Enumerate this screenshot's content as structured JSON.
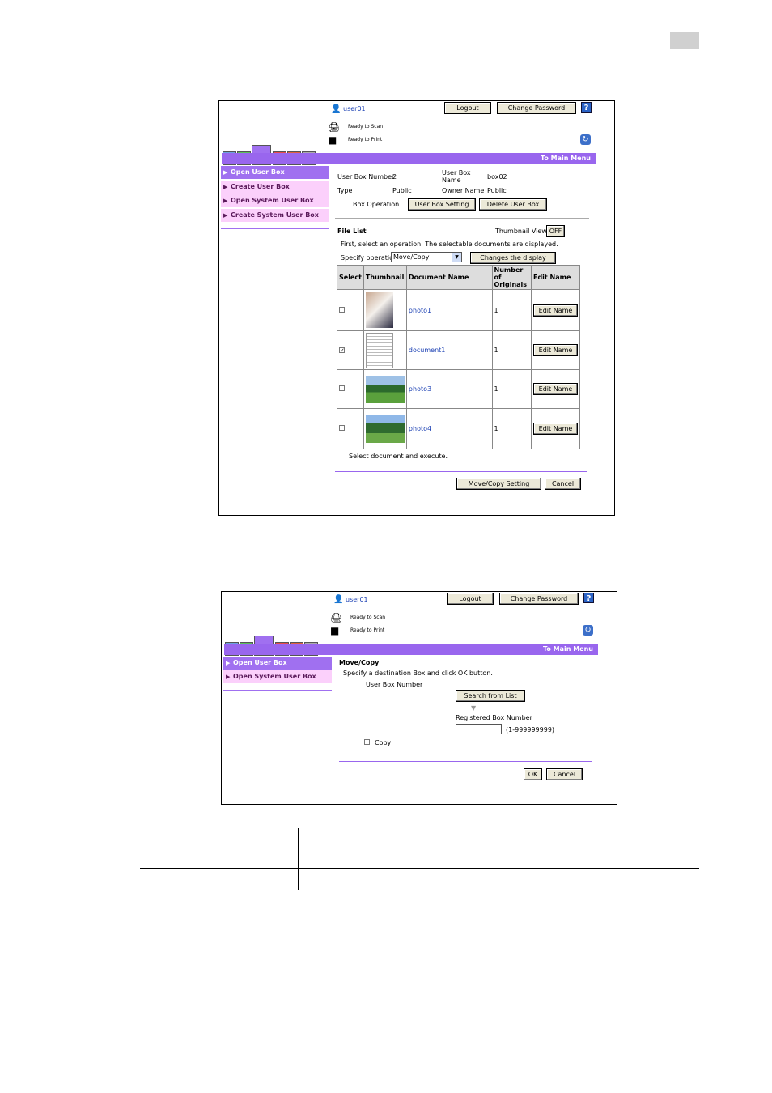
{
  "colors": {
    "accent": "#9966ee",
    "sidebar_active": "#a070f0",
    "sidebar_normal": "#fbd0fb",
    "link": "#1a3fb3"
  },
  "shot1": {
    "user": "user01",
    "logout": "Logout",
    "change_password": "Change Password",
    "help": "?",
    "ready_scan": "Ready to Scan",
    "ready_print": "Ready to Print",
    "to_main_menu": "To Main Menu",
    "sidebar": [
      "Open User Box",
      "Create User Box",
      "Open System User Box",
      "Create System User Box"
    ],
    "info": {
      "box_number_label": "User Box Number",
      "box_number": "2",
      "box_name_label": "User Box Name",
      "box_name": "box02",
      "type_label": "Type",
      "type": "Public",
      "owner_label": "Owner Name",
      "owner": "Public",
      "box_op_label": "Box Operation",
      "user_box_setting": "User Box Setting",
      "delete_user_box": "Delete User Box"
    },
    "file_list": "File List",
    "thumbnail_view": "Thumbnail View",
    "thumbnail_toggle": "OFF",
    "instruction": "First, select an operation. The selectable documents are displayed.",
    "specify_op": "Specify operation",
    "operation": "Move/Copy",
    "change_display": "Changes the display",
    "columns": [
      "Select",
      "Thumbnail",
      "Document Name",
      "Number of Originals",
      "Edit Name"
    ],
    "rows": [
      {
        "name": "photo1",
        "originals": "1",
        "edit": "Edit Name",
        "checked": false
      },
      {
        "name": "document1",
        "originals": "1",
        "edit": "Edit Name",
        "checked": true
      },
      {
        "name": "photo3",
        "originals": "1",
        "edit": "Edit Name",
        "checked": false
      },
      {
        "name": "photo4",
        "originals": "1",
        "edit": "Edit Name",
        "checked": false
      }
    ],
    "select_execute": "Select document and execute.",
    "move_copy_setting": "Move/Copy Setting",
    "cancel": "Cancel"
  },
  "shot2": {
    "user": "user01",
    "logout": "Logout",
    "change_password": "Change Password",
    "help": "?",
    "ready_scan": "Ready to Scan",
    "ready_print": "Ready to Print",
    "to_main_menu": "To Main Menu",
    "sidebar": [
      "Open User Box",
      "Open System User Box"
    ],
    "title": "Move/Copy",
    "instruction": "Specify a destination Box and click OK button.",
    "box_number_label": "User Box Number",
    "search_from_list": "Search from List",
    "registered_label": "Registered Box Number",
    "range": "(1-999999999)",
    "copy_label": "Copy",
    "ok": "OK",
    "cancel": "Cancel"
  }
}
